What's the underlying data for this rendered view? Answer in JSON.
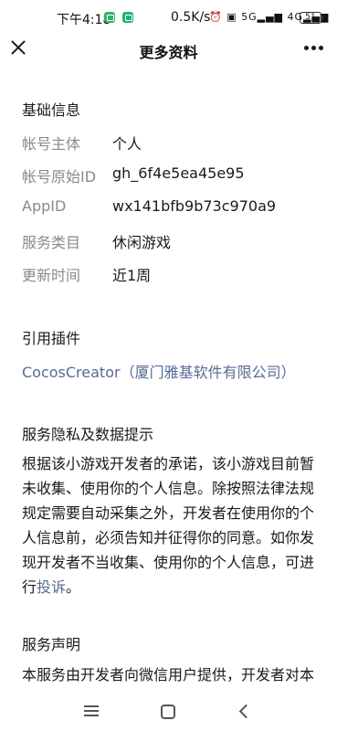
{
  "status_bar": {
    "time": "下午4:18",
    "net_speed": "0.5K/s",
    "signal_text": "⏰ ▣ 5G▂▄▆ 4G▂▄▆",
    "battery": "51"
  },
  "nav": {
    "title": "更多资料"
  },
  "basic_info": {
    "section_title": "基础信息",
    "rows": [
      {
        "label": "帐号主体",
        "value": "个人"
      },
      {
        "label": "帐号原始ID",
        "value": "gh_6f4e5ea45e95"
      },
      {
        "label": "AppID",
        "value": "wx141bfb9b73c970a9"
      },
      {
        "label": "服务类目",
        "value": "休闲游戏"
      },
      {
        "label": "更新时间",
        "value": "近1周"
      }
    ]
  },
  "plugins": {
    "section_title": "引用插件",
    "plugin": "CocosCreator（厦门雅基软件有限公司）"
  },
  "privacy": {
    "section_title": "服务隐私及数据提示",
    "text": "根据该小游戏开发者的承诺，该小游戏目前暂未收集、使用你的个人信息。除按照法律法规规定需要自动采集之外，开发者在使用你的个人信息前，必须告知并征得你的同意。如你发现开发者不当收集、使用你的个人信息，可进行",
    "complaint_link": "投诉",
    "end": "。"
  },
  "statement": {
    "section_title": "服务声明",
    "text": "本服务由开发者向微信用户提供，开发者对本"
  },
  "colors": {
    "link": "#576b95",
    "label": "#8a8a8a",
    "text": "#1a1a1a"
  },
  "icons": {
    "close": "close-icon",
    "more": "more-icon",
    "menu": "menu-icon",
    "home": "home-icon",
    "back": "back-icon"
  }
}
